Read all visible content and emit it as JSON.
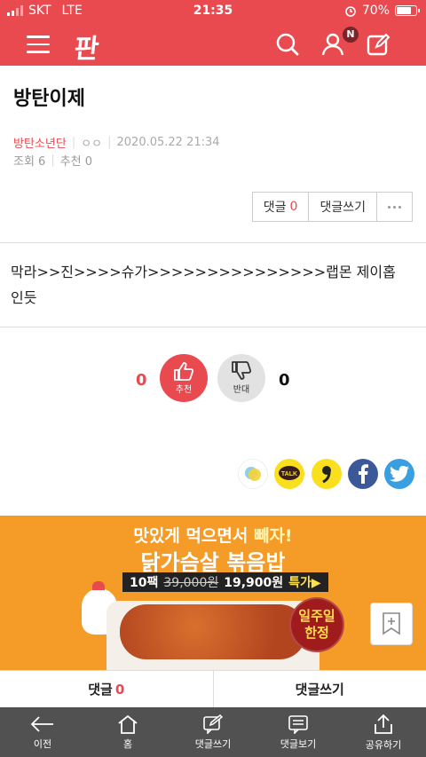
{
  "status_bar": {
    "carrier": "SKT",
    "network": "LTE",
    "time": "21:35",
    "battery": "70%",
    "battery_level": 0.7
  },
  "header": {
    "logo": "판",
    "notification_badge": "N"
  },
  "post": {
    "title": "방탄이제",
    "board": "방탄소년단",
    "author": "ㅇㅇ",
    "datetime": "2020.05.22 21:34",
    "views": "조회 6",
    "recommend": "추천 0",
    "content_line1": "막라>>진>>>>슈가>>>>>>>>>>>>>>>랩몬 제이홉",
    "content_line2": "인듯"
  },
  "comment_buttons": {
    "comment_label": "댓글",
    "comment_count": "0",
    "write_label": "댓글쓰기"
  },
  "reactions": {
    "like_count": "0",
    "like_label": "추천",
    "dislike_label": "반대",
    "dislike_count": "0"
  },
  "ad": {
    "line1_a": "맛있게 먹으면서 ",
    "line1_b": "빼자!",
    "line2": "닭가슴살 볶음밥",
    "pack": "10팩",
    "old_price": "39,000원",
    "new_price": "19,900원",
    "special": "특가▶",
    "badge_line1": "일주일",
    "badge_line2": "한정"
  },
  "bottom_bar": {
    "comment_label": "댓글",
    "comment_count": "0",
    "write_label": "댓글쓰기"
  },
  "tabbar": {
    "items": [
      {
        "label": "이전",
        "icon": "back-arrow-icon"
      },
      {
        "label": "홈",
        "icon": "home-icon"
      },
      {
        "label": "댓글쓰기",
        "icon": "write-comment-icon"
      },
      {
        "label": "댓글보기",
        "icon": "view-comments-icon"
      },
      {
        "label": "공유하기",
        "icon": "share-icon"
      }
    ]
  },
  "colors": {
    "brand": "#e84a4f",
    "tabbar": "#515151",
    "ad_bg": "#f59b27"
  }
}
